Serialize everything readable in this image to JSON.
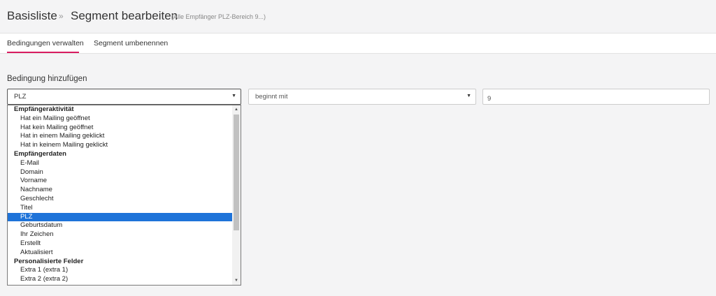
{
  "header": {
    "crumb_root": "Basisliste",
    "separator": "»",
    "crumb_current": "Segment bearbeiten",
    "crumb_sub": "(Alle Empfänger PLZ-Bereich 9...)"
  },
  "tabs": [
    {
      "label": "Bedingungen verwalten",
      "active": true
    },
    {
      "label": "Segment umbenennen",
      "active": false
    }
  ],
  "condition": {
    "section_label": "Bedingung hinzufügen",
    "field_value": "PLZ",
    "operator_value": "beginnt mit",
    "text_value": "9"
  },
  "dropdown": {
    "groups": [
      {
        "label": "Empfängeraktivität",
        "options": [
          "Hat ein Mailing geöffnet",
          "Hat kein Mailing geöffnet",
          "Hat in einem Mailing geklickt",
          "Hat in keinem Mailing geklickt"
        ]
      },
      {
        "label": "Empfängerdaten",
        "options": [
          "E-Mail",
          "Domain",
          "Vorname",
          "Nachname",
          "Geschlecht",
          "Titel",
          "PLZ",
          "Geburtsdatum",
          "Ihr Zeichen",
          "Erstellt",
          "Aktualisiert"
        ]
      },
      {
        "label": "Personalisierte Felder",
        "options": [
          "Extra 1 (extra 1)",
          "Extra 2 (extra 2)"
        ]
      }
    ],
    "selected": "PLZ"
  },
  "icons": {
    "caret": "▼",
    "scroll_up": "▲",
    "scroll_down": "▼"
  },
  "colors": {
    "accent": "#d81b60",
    "selection": "#1e73d9"
  }
}
